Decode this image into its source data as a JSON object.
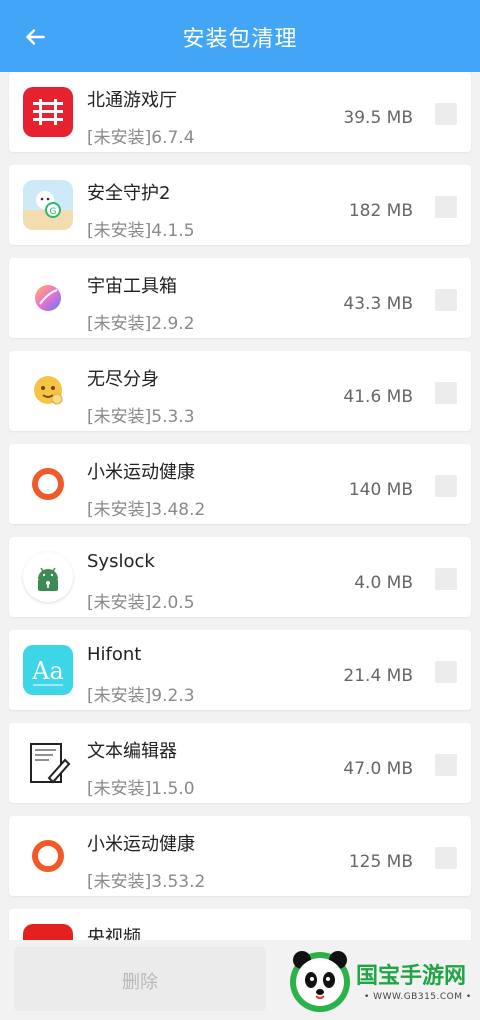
{
  "header": {
    "title": "安装包清理",
    "back_icon": "back-arrow-icon"
  },
  "apps": [
    {
      "name": "北通游戏厅",
      "version": "[未安装]6.7.4",
      "size": "39.5 MB",
      "icon": "betop-icon"
    },
    {
      "name": "安全守护2",
      "version": "[未安装]4.1.5",
      "size": "182 MB",
      "icon": "beach-character-icon"
    },
    {
      "name": "宇宙工具箱",
      "version": "[未安装]2.9.2",
      "size": "43.3 MB",
      "icon": "gradient-circle-icon"
    },
    {
      "name": "无尽分身",
      "version": "[未安装]5.3.3",
      "size": "41.6 MB",
      "icon": "cartoon-face-icon"
    },
    {
      "name": "小米运动健康",
      "version": "[未安装]3.48.2",
      "size": "140 MB",
      "icon": "orange-ring-icon"
    },
    {
      "name": "Syslock",
      "version": "[未安装]2.0.5",
      "size": "4.0 MB",
      "icon": "android-lock-icon"
    },
    {
      "name": "Hifont",
      "version": "[未安装]9.2.3",
      "size": "21.4 MB",
      "icon": "aa-font-icon"
    },
    {
      "name": "文本编辑器",
      "version": "[未安装]1.5.0",
      "size": "47.0 MB",
      "icon": "document-pen-icon"
    },
    {
      "name": "小米运动健康",
      "version": "[未安装]3.53.2",
      "size": "125 MB",
      "icon": "orange-ring-icon"
    },
    {
      "name": "央视频",
      "version": "",
      "size": "",
      "icon": "red-square-icon"
    }
  ],
  "footer": {
    "delete_label": "删除"
  },
  "watermark": {
    "text": "国宝手游网",
    "url": "• WWW.GB315.COM •"
  },
  "colors": {
    "header_bg": "#42a5f5",
    "accent_orange": "#f05a28",
    "app_red": "#e8212e"
  }
}
